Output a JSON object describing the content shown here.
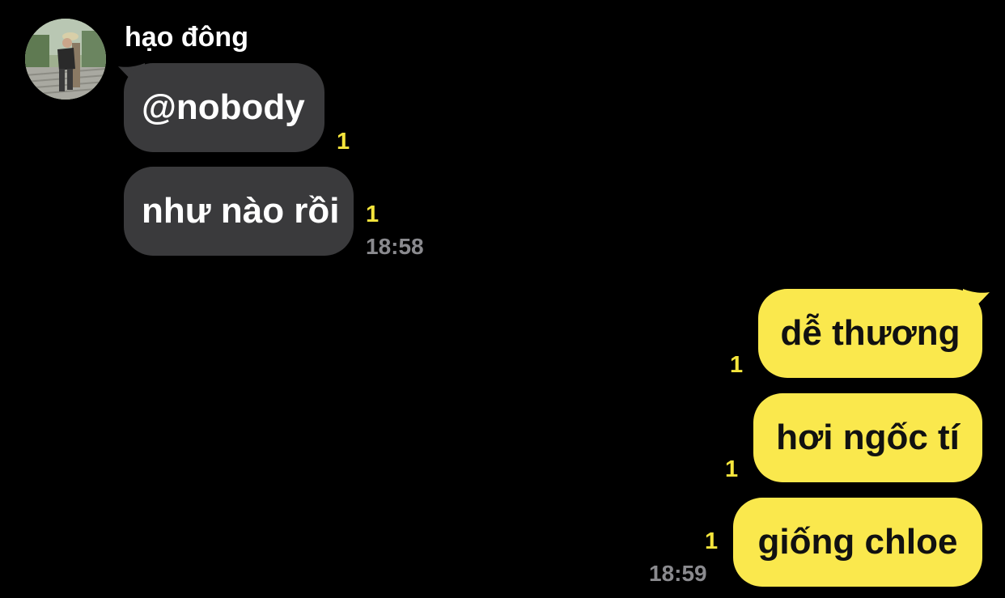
{
  "sender": {
    "name": "hạo đông"
  },
  "received": [
    {
      "text": "@nobody",
      "unread": "1"
    },
    {
      "text": "như nào rồi",
      "unread": "1"
    }
  ],
  "received_time": "18:58",
  "sent": [
    {
      "text": "dễ thương",
      "unread": "1"
    },
    {
      "text": "hơi ngốc tí",
      "unread": "1"
    },
    {
      "text": "giống chloe",
      "unread": "1"
    }
  ],
  "sent_time": "18:59",
  "colors": {
    "background": "#000000",
    "incoming_bubble": "#3a3a3c",
    "outgoing_bubble": "#fae84d",
    "unread_count": "#f5e53c",
    "timestamp": "#8a8a8e"
  }
}
